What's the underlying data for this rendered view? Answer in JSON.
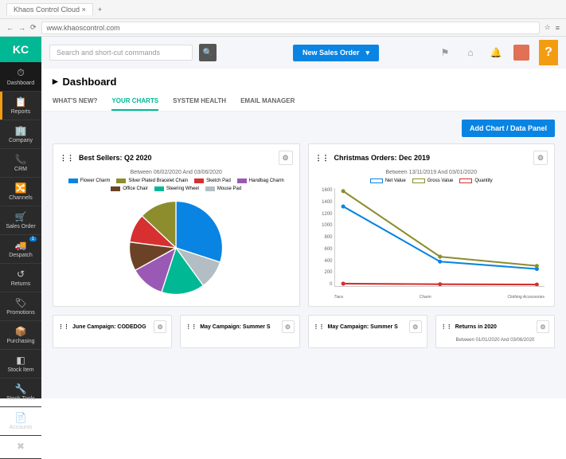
{
  "browser": {
    "tab_title": "Khaos Control Cloud",
    "url": "www.khaoscontrol.com"
  },
  "logo_text": "KC",
  "sidebar": {
    "items": [
      {
        "icon": "⏱",
        "label": "Dashboard",
        "active": true
      },
      {
        "icon": "📋",
        "label": "Reports",
        "accent": "#f39c12"
      },
      {
        "icon": "🏢",
        "label": "Company"
      },
      {
        "icon": "📞",
        "label": "CRM"
      },
      {
        "icon": "🔀",
        "label": "Channels"
      },
      {
        "icon": "🛒",
        "label": "Sales Order"
      },
      {
        "icon": "🚚",
        "label": "Despatch",
        "badge": "1"
      },
      {
        "icon": "↺",
        "label": "Returns"
      },
      {
        "icon": "🏷",
        "label": "Promotions"
      },
      {
        "icon": "📦",
        "label": "Purchasing"
      },
      {
        "icon": "◧",
        "label": "Stock Item"
      },
      {
        "icon": "🔧",
        "label": "Stock Tools"
      },
      {
        "icon": "📄",
        "label": "Accounts"
      },
      {
        "icon": "✖",
        "label": ""
      }
    ]
  },
  "topbar": {
    "search_placeholder": "Search and short-cut commands",
    "new_order_label": "New Sales Order"
  },
  "page_title": "Dashboard",
  "tabs": [
    {
      "label": "WHAT'S NEW?"
    },
    {
      "label": "YOUR CHARTS",
      "active": true
    },
    {
      "label": "SYSTEM HEALTH"
    },
    {
      "label": "EMAIL MANAGER"
    }
  ],
  "add_chart_label": "Add Chart / Data Panel",
  "panel1": {
    "title": "Best Sellers: Q2 2020",
    "subtitle": "Between 06/02/2020 And 03/06/2020",
    "legend": [
      {
        "label": "Flower Charm",
        "color": "#0984e3"
      },
      {
        "label": "Silver Plated Bracelet Chain",
        "color": "#8d8d2e"
      },
      {
        "label": "Sketch Pad",
        "color": "#d63031"
      },
      {
        "label": "Handbag Charm",
        "color": "#9b59b6"
      },
      {
        "label": "Office Chair",
        "color": "#6b4226"
      },
      {
        "label": "Steering Wheel",
        "color": "#00b894"
      },
      {
        "label": "Mouse Pad",
        "color": "#b2bec3"
      }
    ]
  },
  "panel2": {
    "title": "Christmas Orders: Dec 2019",
    "subtitle": "Between 13/11/2019 And 03/01/2020",
    "legend": [
      {
        "label": "Net Value",
        "color": "#0984e3"
      },
      {
        "label": "Gross Value",
        "color": "#8d8d2e"
      },
      {
        "label": "Quantity",
        "color": "#d63031"
      }
    ],
    "y_ticks": [
      "1600",
      "1400",
      "1200",
      "1000",
      "800",
      "600",
      "400",
      "200",
      "0"
    ],
    "x_ticks": [
      "Tiara",
      "Charm",
      "Clothing Accessories"
    ]
  },
  "small_panels": [
    {
      "title": "June Campaign: CODEDOG"
    },
    {
      "title": "May Campaign: Summer S"
    },
    {
      "title": "May Campaign: Summer S"
    },
    {
      "title": "Returns in 2020",
      "subtitle": "Between 01/01/2020 And 03/06/2020"
    }
  ],
  "chart_data": [
    {
      "type": "pie",
      "title": "Best Sellers: Q2 2020",
      "series": [
        {
          "name": "Flower Charm",
          "value": 30,
          "color": "#0984e3"
        },
        {
          "name": "Mouse Pad",
          "value": 10,
          "color": "#b2bec3"
        },
        {
          "name": "Steering Wheel",
          "value": 15,
          "color": "#00b894"
        },
        {
          "name": "Handbag Charm",
          "value": 12,
          "color": "#9b59b6"
        },
        {
          "name": "Office Chair",
          "value": 10,
          "color": "#6b4226"
        },
        {
          "name": "Sketch Pad",
          "value": 10,
          "color": "#d63031"
        },
        {
          "name": "Silver Plated Bracelet Chain",
          "value": 13,
          "color": "#8d8d2e"
        }
      ]
    },
    {
      "type": "line",
      "title": "Christmas Orders: Dec 2019",
      "x": [
        "Tiara",
        "Charm",
        "Clothing Accessories"
      ],
      "series": [
        {
          "name": "Net Value",
          "values": [
            1300,
            400,
            280
          ],
          "color": "#0984e3"
        },
        {
          "name": "Gross Value",
          "values": [
            1550,
            480,
            330
          ],
          "color": "#8d8d2e"
        },
        {
          "name": "Quantity",
          "values": [
            40,
            30,
            25
          ],
          "color": "#d63031"
        }
      ],
      "ylim": [
        0,
        1600
      ],
      "xlabel": "",
      "ylabel": ""
    }
  ]
}
